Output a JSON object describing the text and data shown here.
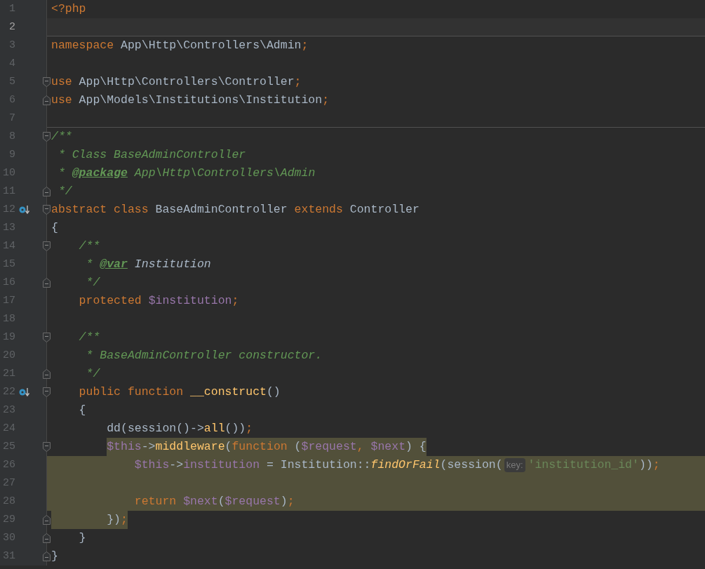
{
  "editor": {
    "lines": [
      {
        "n": "1",
        "tokens": [
          {
            "kind": "kw",
            "text": "<?php"
          }
        ]
      },
      {
        "n": "2",
        "current": true,
        "separator": true
      },
      {
        "n": "3",
        "tokens": [
          {
            "kind": "kw",
            "text": "namespace "
          },
          {
            "kind": "plain",
            "text": "App\\Http\\Controllers\\Admin"
          },
          {
            "kind": "kw",
            "text": ";"
          }
        ]
      },
      {
        "n": "4"
      },
      {
        "n": "5",
        "fold_start": true,
        "tokens": [
          {
            "kind": "kw",
            "text": "use "
          },
          {
            "kind": "plain",
            "text": "App\\Http\\Controllers\\Controller"
          },
          {
            "kind": "kw",
            "text": ";"
          }
        ]
      },
      {
        "n": "6",
        "fold_end": true,
        "tokens": [
          {
            "kind": "kw",
            "text": "use "
          },
          {
            "kind": "plain",
            "text": "App\\Models\\Institutions\\Institution"
          },
          {
            "kind": "kw",
            "text": ";"
          }
        ]
      },
      {
        "n": "7",
        "separator": true
      },
      {
        "n": "8",
        "fold_start": true,
        "tokens": [
          {
            "kind": "comment",
            "text": "/**"
          }
        ]
      },
      {
        "n": "9",
        "tokens": [
          {
            "kind": "comment",
            "text": " * Class BaseAdminController"
          }
        ]
      },
      {
        "n": "10",
        "tokens": [
          {
            "kind": "comment",
            "text": " * "
          },
          {
            "kind": "doctag",
            "text": "@package"
          },
          {
            "kind": "comment",
            "text": " App\\Http\\Controllers\\Admin"
          }
        ]
      },
      {
        "n": "11",
        "fold_end": true,
        "tokens": [
          {
            "kind": "comment",
            "text": " */"
          }
        ]
      },
      {
        "n": "12",
        "fold_start": true,
        "marker": true,
        "tokens": [
          {
            "kind": "kw",
            "text": "abstract class "
          },
          {
            "kind": "plain",
            "text": "BaseAdminController "
          },
          {
            "kind": "kw",
            "text": "extends "
          },
          {
            "kind": "plain",
            "text": "Controller"
          }
        ]
      },
      {
        "n": "13",
        "tokens": [
          {
            "kind": "plain",
            "text": "{"
          }
        ],
        "children": [
          {
            "n": "14",
            "fold_start": true,
            "tokens": [
              {
                "kind": "comment",
                "text": "/**"
              }
            ]
          },
          {
            "n": "15",
            "tokens": [
              {
                "kind": "comment",
                "text": " * "
              },
              {
                "kind": "doctag",
                "text": "@var"
              },
              {
                "kind": "doctype",
                "text": " Institution"
              }
            ]
          },
          {
            "n": "16",
            "fold_end": true,
            "tokens": [
              {
                "kind": "comment",
                "text": " */"
              }
            ]
          },
          {
            "n": "17",
            "tokens": [
              {
                "kind": "kw",
                "text": "protected "
              },
              {
                "kind": "var",
                "text": "$institution"
              },
              {
                "kind": "kw",
                "text": ";"
              }
            ]
          },
          {
            "n": "18"
          },
          {
            "n": "19",
            "fold_start": true,
            "tokens": [
              {
                "kind": "comment",
                "text": "/**"
              }
            ]
          },
          {
            "n": "20",
            "tokens": [
              {
                "kind": "comment",
                "text": " * BaseAdminController constructor."
              }
            ]
          },
          {
            "n": "21",
            "fold_end": true,
            "tokens": [
              {
                "kind": "comment",
                "text": " */"
              }
            ]
          },
          {
            "n": "22",
            "fold_start": true,
            "marker": true,
            "tokens": [
              {
                "kind": "kw",
                "text": "public function "
              },
              {
                "kind": "func",
                "text": "__construct"
              },
              {
                "kind": "plain",
                "text": "()"
              }
            ]
          },
          {
            "n": "23",
            "tokens": [
              {
                "kind": "plain",
                "text": "{"
              }
            ],
            "children": [
              {
                "n": "24",
                "tokens": [
                  {
                    "kind": "plain",
                    "text": "dd(session()->"
                  },
                  {
                    "kind": "func",
                    "text": "all"
                  },
                  {
                    "kind": "plain",
                    "text": "())"
                  },
                  {
                    "kind": "kw",
                    "text": ";"
                  }
                ]
              },
              {
                "n": "25",
                "fold_start": true,
                "highlight_text": true,
                "tokens": [
                  {
                    "kind": "var",
                    "text": "$this"
                  },
                  {
                    "kind": "plain",
                    "text": "->"
                  },
                  {
                    "kind": "func",
                    "text": "middleware"
                  },
                  {
                    "kind": "plain",
                    "text": "("
                  },
                  {
                    "kind": "kw",
                    "text": "function "
                  },
                  {
                    "kind": "plain",
                    "text": "("
                  },
                  {
                    "kind": "var",
                    "text": "$request"
                  },
                  {
                    "kind": "kw",
                    "text": ", "
                  },
                  {
                    "kind": "var",
                    "text": "$next"
                  },
                  {
                    "kind": "plain",
                    "text": ") {"
                  }
                ],
                "children": [
                  {
                    "n": "26",
                    "highlight_row": true,
                    "tokens": [
                      {
                        "kind": "var",
                        "text": "$this"
                      },
                      {
                        "kind": "plain",
                        "text": "->"
                      },
                      {
                        "kind": "var",
                        "text": "institution"
                      },
                      {
                        "kind": "plain",
                        "text": " = Institution::"
                      },
                      {
                        "kind": "static",
                        "text": "findOrFail"
                      },
                      {
                        "kind": "plain",
                        "text": "(session("
                      },
                      {
                        "kind": "hint",
                        "text": "key:"
                      },
                      {
                        "kind": "string",
                        "text": "'institution_id'"
                      },
                      {
                        "kind": "plain",
                        "text": "))"
                      },
                      {
                        "kind": "kw",
                        "text": ";"
                      }
                    ]
                  },
                  {
                    "n": "27",
                    "highlight_row": true
                  },
                  {
                    "n": "28",
                    "highlight_row": true,
                    "tokens": [
                      {
                        "kind": "kw",
                        "text": "return "
                      },
                      {
                        "kind": "var",
                        "text": "$next"
                      },
                      {
                        "kind": "plain",
                        "text": "("
                      },
                      {
                        "kind": "var",
                        "text": "$request"
                      },
                      {
                        "kind": "plain",
                        "text": ")"
                      },
                      {
                        "kind": "kw",
                        "text": ";"
                      }
                    ]
                  }
                ]
              },
              {
                "n": "29",
                "fold_end": true,
                "highlight_text": true,
                "highlight_indent": true,
                "tokens": [
                  {
                    "kind": "plain",
                    "text": "})"
                  },
                  {
                    "kind": "kw",
                    "text": ";"
                  }
                ]
              }
            ]
          },
          {
            "n": "30",
            "fold_end": true,
            "tokens": [
              {
                "kind": "plain",
                "text": "}"
              }
            ]
          }
        ]
      },
      {
        "n": "31",
        "fold_end": true,
        "tokens": [
          {
            "kind": "plain",
            "text": "}"
          }
        ]
      }
    ]
  }
}
